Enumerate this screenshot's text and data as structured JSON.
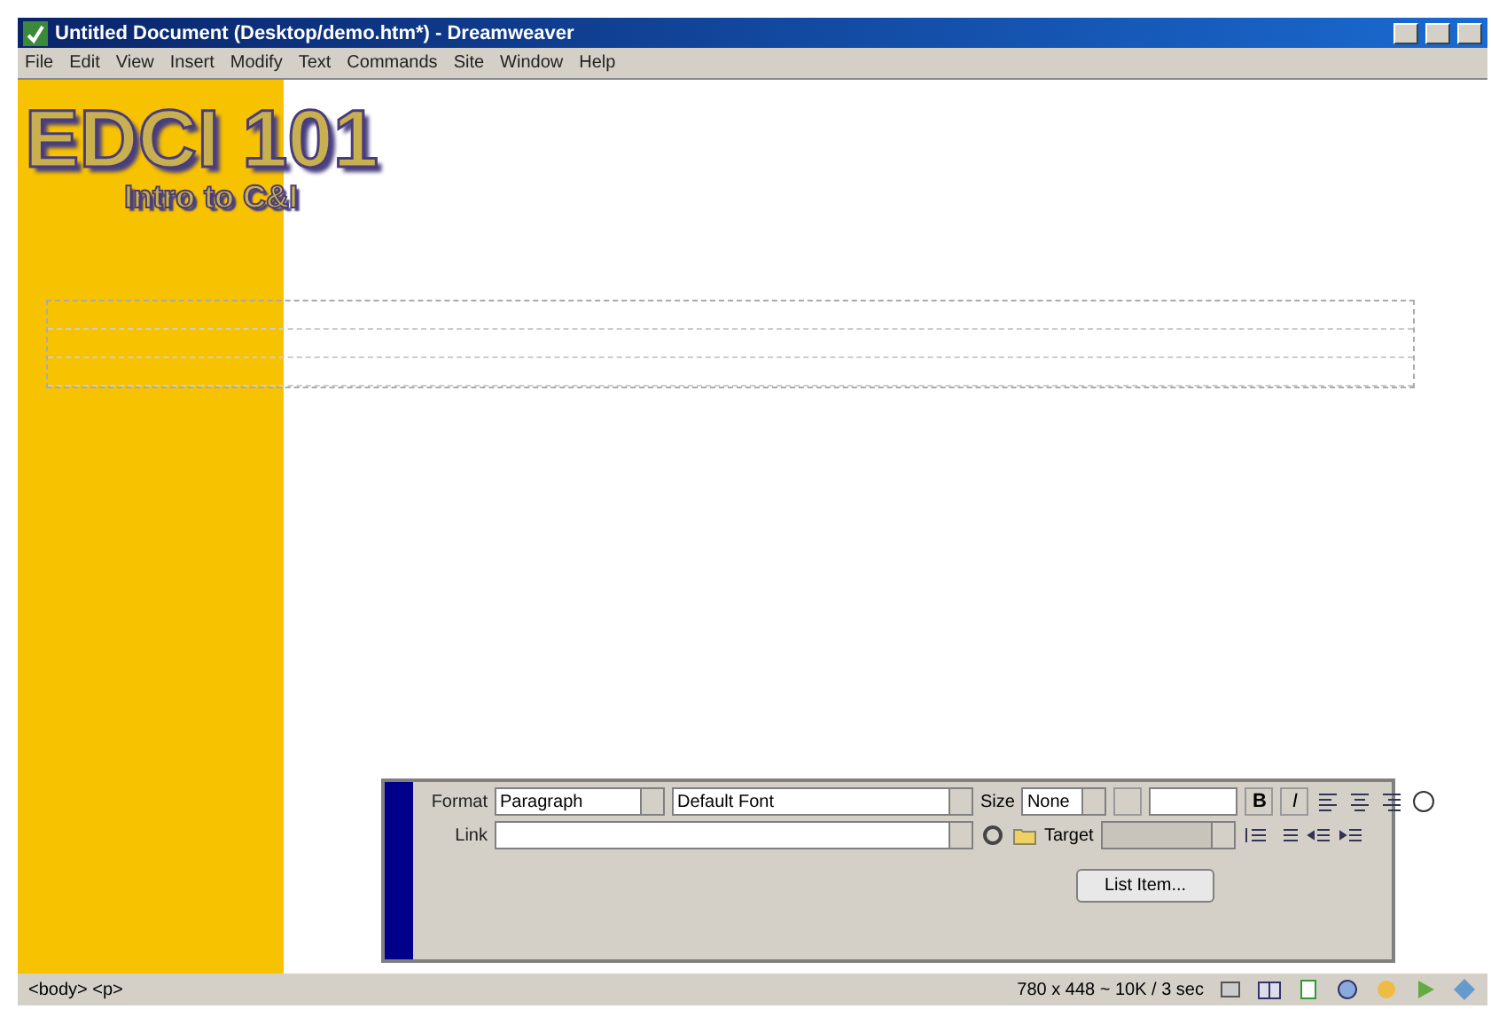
{
  "window": {
    "title": "Untitled Document (Desktop/demo.htm*) - Dreamweaver"
  },
  "menu": [
    "File",
    "Edit",
    "View",
    "Insert",
    "Modify",
    "Text",
    "Commands",
    "Site",
    "Window",
    "Help"
  ],
  "page": {
    "heading": "EDCI 101",
    "subheading": "Intro to C&I"
  },
  "properties": {
    "format_label": "Format",
    "format": "Paragraph",
    "font": "Default Font",
    "size_label": "Size",
    "size": "None",
    "link_label": "Link",
    "target_label": "Target",
    "list_button": "List Item...",
    "bold": "B",
    "italic": "I"
  },
  "status_bar": {
    "tags": "<body> <p>",
    "info": "780 x 448 ~ 10K / 3 sec"
  }
}
